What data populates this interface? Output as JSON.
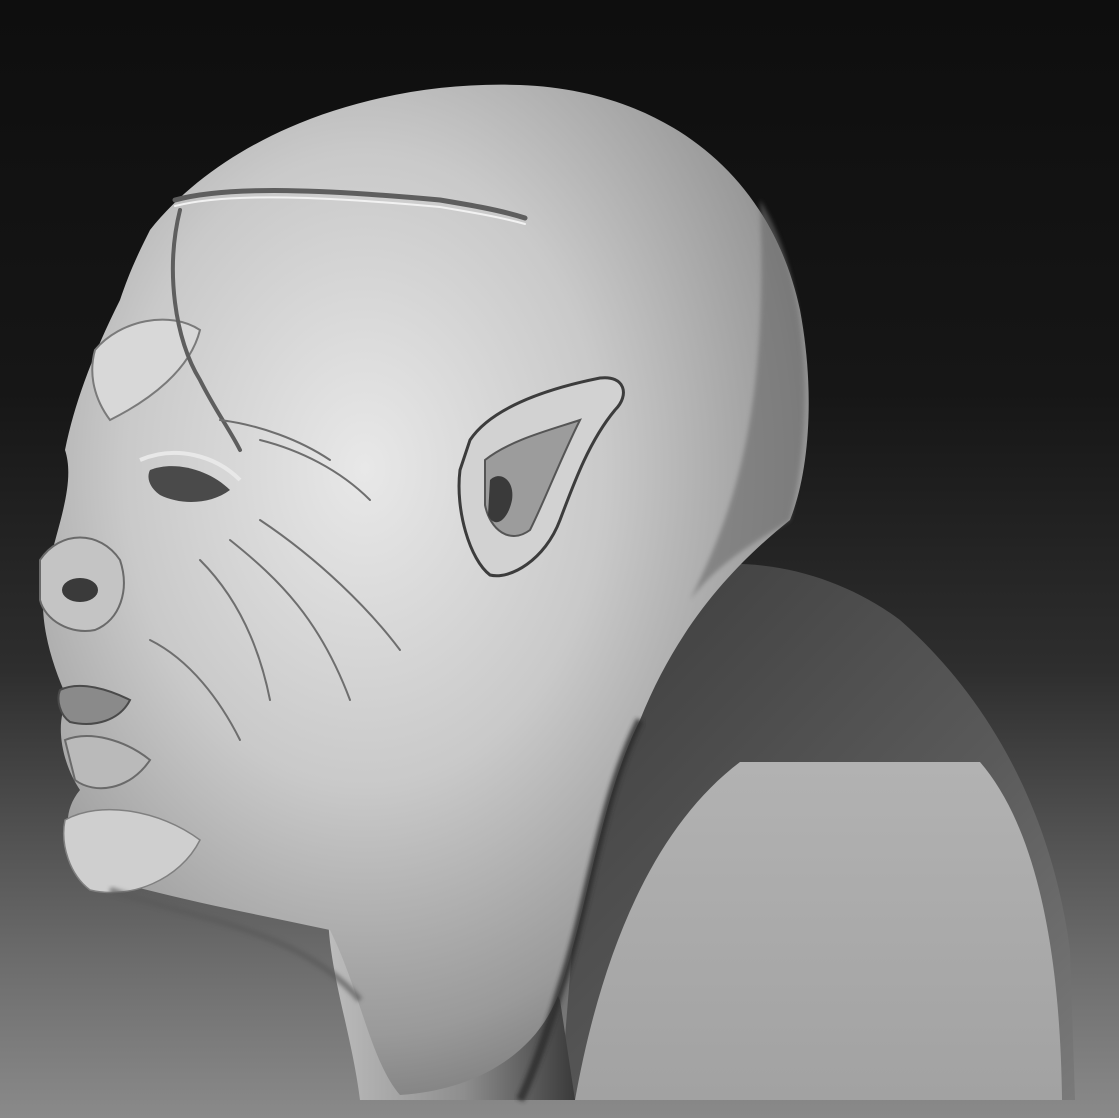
{
  "scene": {
    "subject": "sculpted-bust",
    "colors": {
      "background_top": "#0e0e0e",
      "background_bottom": "#8a8a8a",
      "clay_light": "#e6e6e6",
      "clay_mid": "#b4b4b4",
      "clay_shadow": "#4a4a4a",
      "cut_plane": "#a9a9a9"
    }
  }
}
